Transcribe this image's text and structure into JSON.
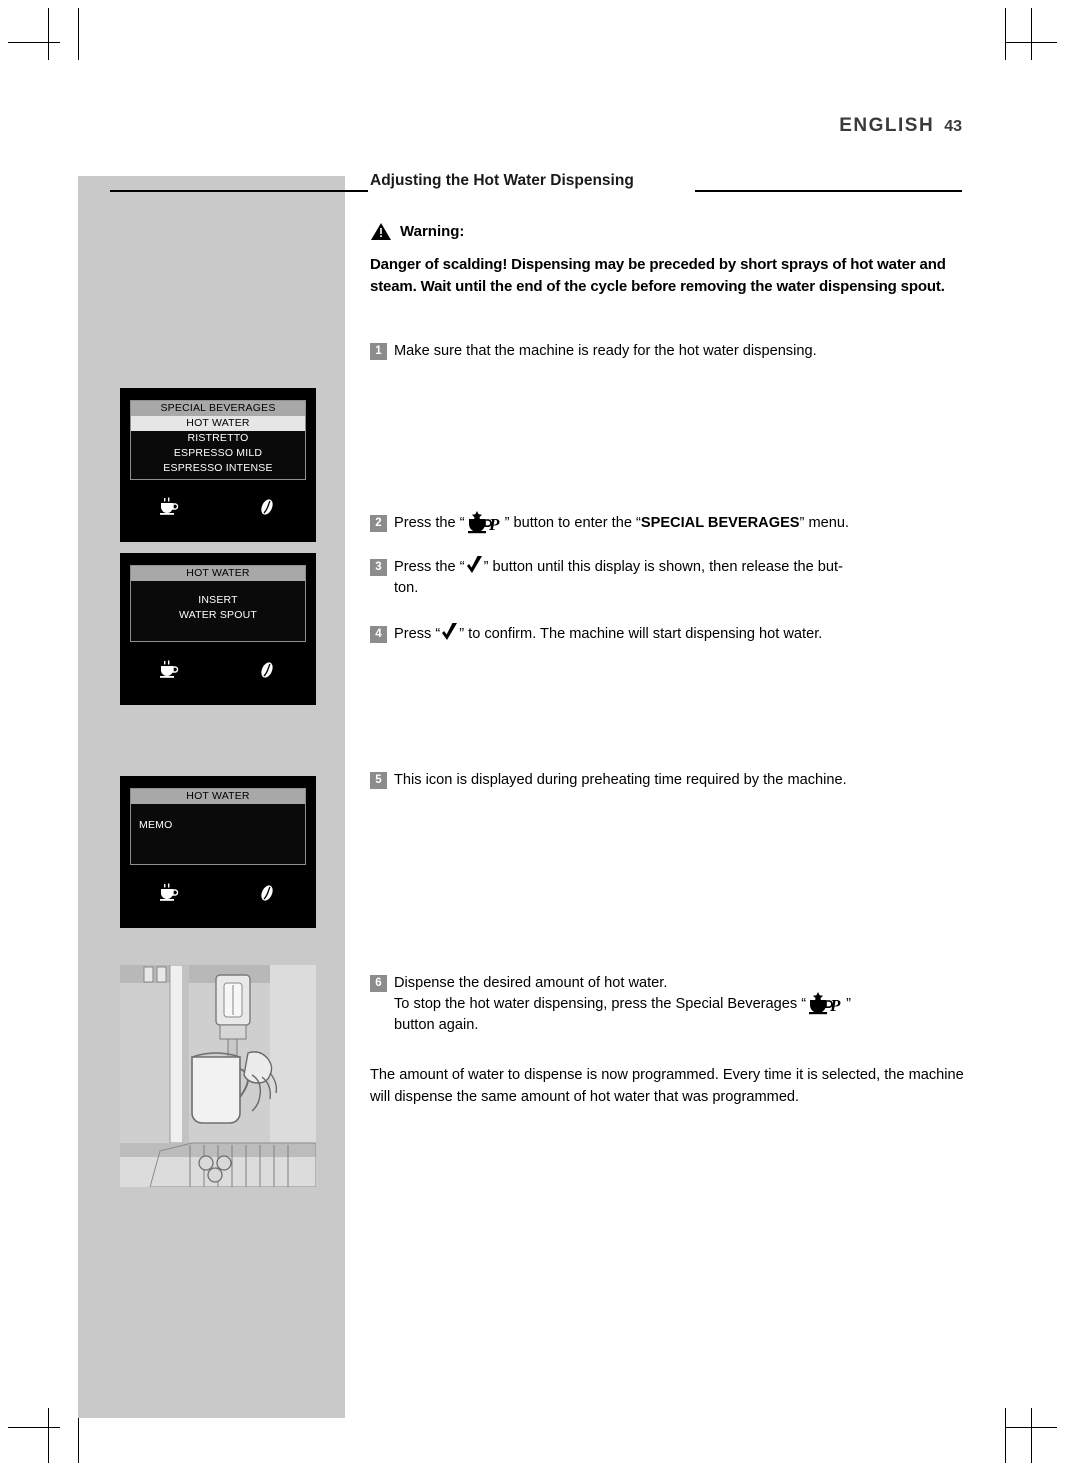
{
  "header": {
    "language": "ENGLISH",
    "page_number": "43"
  },
  "section": {
    "title": "Adjusting the Hot Water Dispensing"
  },
  "warning": {
    "label": "Warning:",
    "text": "Danger of scalding! Dispensing may be preceded by short sprays of hot water and steam. Wait until the end of the cycle before removing the water dispensing spout."
  },
  "steps": [
    {
      "num": "1",
      "text": "Make sure that the machine is ready for the hot water dispensing."
    },
    {
      "num": "2",
      "pre": "Press the “",
      "post": "” button to enter the “",
      "bold": "SPECIAL BEVERAGES",
      "tail": "” menu."
    },
    {
      "num": "3",
      "pre": "Press the “",
      "post": "” button until this display is shown, then release the but-",
      "line2": "ton."
    },
    {
      "num": "4",
      "pre": "Press “",
      "post": "” to confirm. The machine will start dispensing hot water."
    },
    {
      "num": "5",
      "text": "This icon is displayed during preheating time required by the machine."
    },
    {
      "num": "6",
      "text": "Dispense the desired amount of hot water.",
      "line2_pre": "To stop the hot water dispensing, press the Special Beverages “",
      "line2_post": "”",
      "line3": "button again."
    }
  ],
  "closing_paragraph": "The amount of water to dispense is now programmed. Every time it is selected, the machine will dispense the same amount of hot water that was programmed.",
  "displays": [
    {
      "name": "special-beverages-menu",
      "title": "SPECIAL BEVERAGES",
      "lines": [
        "HOT WATER",
        "RISTRETTO",
        "ESPRESSO MILD",
        "ESPRESSO INTENSE"
      ],
      "selected_index": 0
    },
    {
      "name": "insert-water-spout",
      "title": "HOT WATER",
      "lines": [
        "INSERT",
        "WATER SPOUT"
      ]
    },
    {
      "name": "hot-water-memo",
      "title": "HOT WATER",
      "lines": [
        "MEMO"
      ]
    }
  ],
  "icons": {
    "cup": "cup-icon",
    "bean": "coffee-bean-icon",
    "special_beverages_button": "special-beverages-button-icon",
    "check_button": "check-button-icon",
    "warning_triangle": "warning-triangle-icon"
  }
}
